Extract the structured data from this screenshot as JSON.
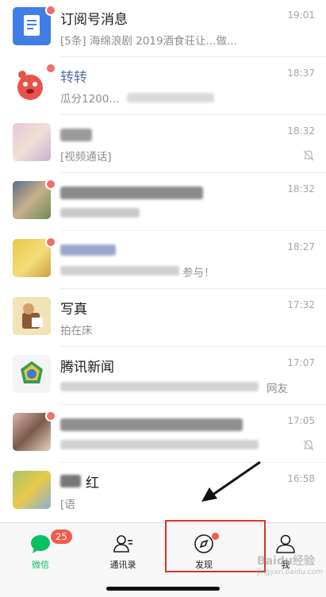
{
  "chats": [
    {
      "title": "订阅号消息",
      "subtitle": "[5条] 海绵浪剧 2019酒食荘让...做...",
      "time": "19:01",
      "unread_dot": true,
      "muted": false
    },
    {
      "title": "转转",
      "subtitle": "瓜分1200...",
      "time": "18:37",
      "unread_dot": true,
      "muted": false
    },
    {
      "title": "",
      "subtitle": "[视频通话]",
      "time": "18:32",
      "unread_dot": false,
      "muted": true
    },
    {
      "title": "",
      "subtitle": "",
      "time": "18:32",
      "unread_dot": true,
      "muted": false
    },
    {
      "title": "",
      "subtitle": "参与！",
      "time": "18:27",
      "unread_dot": true,
      "muted": false
    },
    {
      "title": "写真",
      "subtitle": "拍在床",
      "time": "17:32",
      "unread_dot": false,
      "muted": false
    },
    {
      "title": "腾讯新闻",
      "subtitle": "网友",
      "time": "17:07",
      "unread_dot": false,
      "muted": false
    },
    {
      "title": "",
      "subtitle": "",
      "time": "17:05",
      "unread_dot": true,
      "muted": true
    },
    {
      "title": "红",
      "subtitle": "[语",
      "time": "16:58",
      "unread_dot": false,
      "muted": false
    }
  ],
  "tabbar": {
    "wechat": {
      "label": "微信",
      "badge": "25",
      "icon": "chat-bubble-icon",
      "color": "#07c160"
    },
    "contacts": {
      "label": "通讯录",
      "icon": "contacts-icon"
    },
    "discover": {
      "label": "发现",
      "icon": "compass-icon",
      "red_dot": true
    },
    "me": {
      "label": "我",
      "icon": "person-icon"
    }
  },
  "watermark": {
    "brand": "Baidu经验",
    "url": "jingyan.baidu.com"
  },
  "colors": {
    "accent": "#07c160",
    "badge": "#f25b4b",
    "highlight": "#e0302a"
  }
}
